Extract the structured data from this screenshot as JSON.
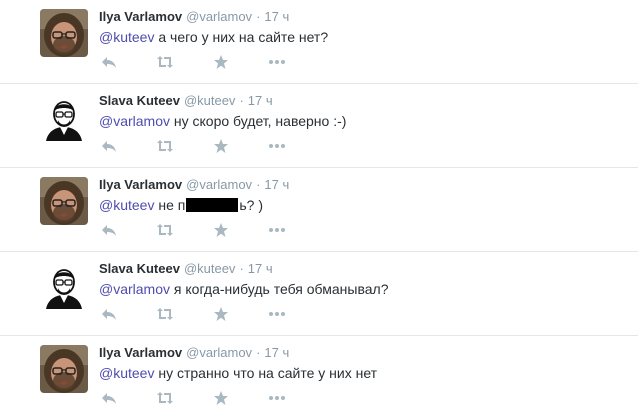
{
  "icons": {
    "reply": "reply-icon",
    "retweet": "retweet-icon",
    "favorite": "favorite-star-icon",
    "more": "more-dots-icon"
  },
  "colors": {
    "mention": "#4e4cae",
    "meta": "#8899a6",
    "icon": "#aab8c2",
    "divider": "#e1e8ed"
  },
  "tweets": [
    {
      "avatar": "varlamov",
      "fullname": "Ilya Varlamov",
      "username": "@varlamov",
      "dot": "·",
      "time": "17 ч",
      "mention": "@kuteev",
      "text": " а чего у них на сайте нет?"
    },
    {
      "avatar": "kuteev",
      "fullname": "Slava Kuteev",
      "username": "@kuteev",
      "dot": "·",
      "time": "17 ч",
      "mention": "@varlamov",
      "text": " ну скоро будет, наверно :-)"
    },
    {
      "avatar": "varlamov",
      "fullname": "Ilya Varlamov",
      "username": "@varlamov",
      "dot": "·",
      "time": "17 ч",
      "mention": "@kuteev",
      "text_before": " не п",
      "text_after": "ь? )"
    },
    {
      "avatar": "kuteev",
      "fullname": "Slava Kuteev",
      "username": "@kuteev",
      "dot": "·",
      "time": "17 ч",
      "mention": "@varlamov",
      "text": " я когда-нибудь тебя обманывал?"
    },
    {
      "avatar": "varlamov",
      "fullname": "Ilya Varlamov",
      "username": "@varlamov",
      "dot": "·",
      "time": "17 ч",
      "mention": "@kuteev",
      "text": " ну странно что на сайте у них нет"
    }
  ]
}
